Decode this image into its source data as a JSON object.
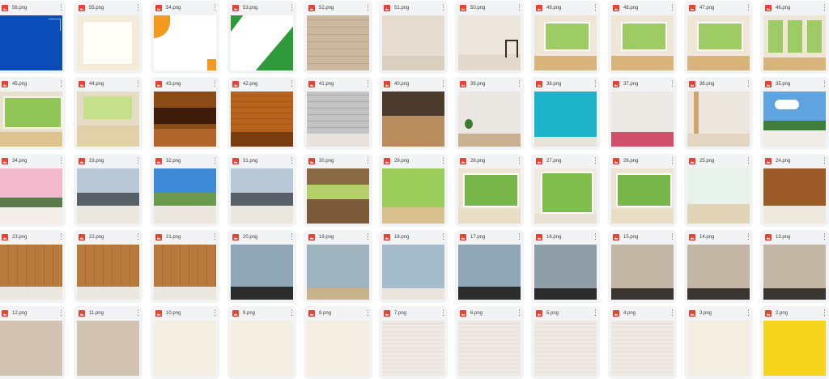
{
  "files": [
    {
      "name": "56.png",
      "kind": "blue"
    },
    {
      "name": "55.png",
      "kind": "floral"
    },
    {
      "name": "54.png",
      "kind": "orange"
    },
    {
      "name": "53.png",
      "kind": "green-stripe"
    },
    {
      "name": "52.png",
      "kind": "stone"
    },
    {
      "name": "51.png",
      "kind": "room-beige"
    },
    {
      "name": "50.png",
      "kind": "room-chair"
    },
    {
      "name": "49.png",
      "kind": "window"
    },
    {
      "name": "48.png",
      "kind": "window"
    },
    {
      "name": "47.png",
      "kind": "window"
    },
    {
      "name": "46.png",
      "kind": "window-tall"
    },
    {
      "name": "45.png",
      "kind": "window-wide"
    },
    {
      "name": "44.png",
      "kind": "window-bright"
    },
    {
      "name": "43.png",
      "kind": "dark-wood"
    },
    {
      "name": "42.png",
      "kind": "orange-wood"
    },
    {
      "name": "41.png",
      "kind": "brick-gray"
    },
    {
      "name": "40.png",
      "kind": "cafe"
    },
    {
      "name": "39.png",
      "kind": "plant"
    },
    {
      "name": "38.png",
      "kind": "teal"
    },
    {
      "name": "37.png",
      "kind": "pink-floor"
    },
    {
      "name": "36.png",
      "kind": "room-plain"
    },
    {
      "name": "35.png",
      "kind": "sky"
    },
    {
      "name": "34.png",
      "kind": "cherry"
    },
    {
      "name": "33.png",
      "kind": "street"
    },
    {
      "name": "32.png",
      "kind": "street-sky"
    },
    {
      "name": "31.png",
      "kind": "street"
    },
    {
      "name": "30.png",
      "kind": "table-green"
    },
    {
      "name": "29.png",
      "kind": "green-blur"
    },
    {
      "name": "28.png",
      "kind": "window-green"
    },
    {
      "name": "27.png",
      "kind": "window-trees"
    },
    {
      "name": "26.png",
      "kind": "window-green"
    },
    {
      "name": "25.png",
      "kind": "mint"
    },
    {
      "name": "24.png",
      "kind": "brown-wood"
    },
    {
      "name": "23.png",
      "kind": "wood"
    },
    {
      "name": "22.png",
      "kind": "wood"
    },
    {
      "name": "21.png",
      "kind": "wood"
    },
    {
      "name": "20.png",
      "kind": "blue-gray"
    },
    {
      "name": "19.png",
      "kind": "blue-gray-light"
    },
    {
      "name": "18.png",
      "kind": "blue-light"
    },
    {
      "name": "17.png",
      "kind": "blue-gray"
    },
    {
      "name": "16.png",
      "kind": "slate"
    },
    {
      "name": "15.png",
      "kind": "taupe"
    },
    {
      "name": "14.png",
      "kind": "taupe"
    },
    {
      "name": "13.png",
      "kind": "taupe"
    },
    {
      "name": "12.png",
      "kind": "beige"
    },
    {
      "name": "11.png",
      "kind": "beige"
    },
    {
      "name": "10.png",
      "kind": "cream"
    },
    {
      "name": "9.png",
      "kind": "cream"
    },
    {
      "name": "8.png",
      "kind": "cream"
    },
    {
      "name": "7.png",
      "kind": "white-tex"
    },
    {
      "name": "6.png",
      "kind": "white-tex"
    },
    {
      "name": "5.png",
      "kind": "white-tex"
    },
    {
      "name": "4.png",
      "kind": "white-tex"
    },
    {
      "name": "3.png",
      "kind": "cream"
    },
    {
      "name": "2.png",
      "kind": "yellow"
    }
  ]
}
